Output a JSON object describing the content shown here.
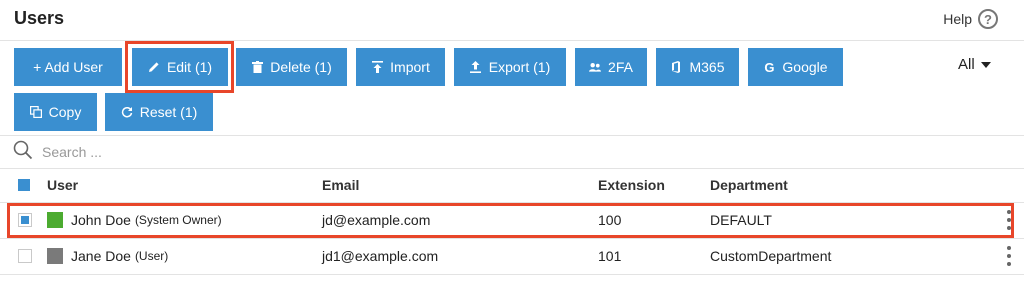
{
  "header": {
    "title": "Users",
    "help_label": "Help",
    "help_icon_glyph": "?"
  },
  "toolbar": {
    "add_user": "+ Add User",
    "edit": "Edit (1)",
    "delete": "Delete (1)",
    "import": "Import",
    "export": "Export (1)",
    "twofa": "2FA",
    "m365": "M365",
    "google": "Google",
    "copy": "Copy",
    "reset": "Reset (1)",
    "filter_value": "All"
  },
  "search": {
    "placeholder": "Search ..."
  },
  "table": {
    "columns": [
      "User",
      "Email",
      "Extension",
      "Department"
    ],
    "rows": [
      {
        "name": "John Doe",
        "role": "(System Owner)",
        "email": "jd@example.com",
        "extension": "100",
        "department": "DEFAULT",
        "selected": true,
        "color": "#4cab30"
      },
      {
        "name": "Jane Doe",
        "role": "(User)",
        "email": "jd1@example.com",
        "extension": "101",
        "department": "CustomDepartment",
        "selected": false,
        "color": "#7a7a7a"
      }
    ]
  },
  "colors": {
    "primary_button": "#3a8fd0",
    "highlight": "#e8462a"
  }
}
